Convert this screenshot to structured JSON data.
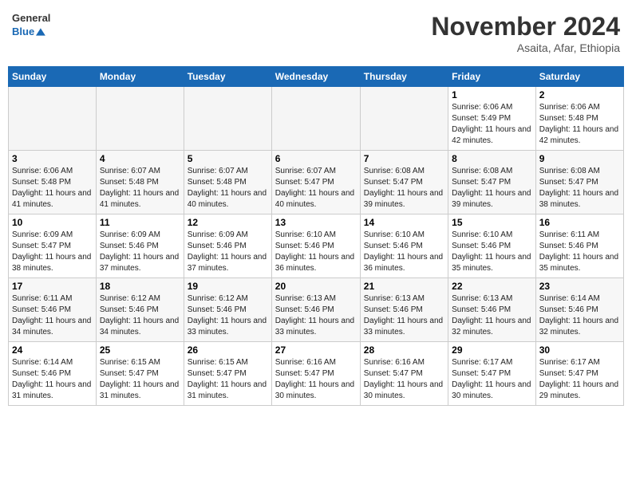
{
  "logo": {
    "line1": "General",
    "line2": "Blue"
  },
  "title": "November 2024",
  "subtitle": "Asaita, Afar, Ethiopia",
  "days_of_week": [
    "Sunday",
    "Monday",
    "Tuesday",
    "Wednesday",
    "Thursday",
    "Friday",
    "Saturday"
  ],
  "weeks": [
    [
      {
        "day": "",
        "info": ""
      },
      {
        "day": "",
        "info": ""
      },
      {
        "day": "",
        "info": ""
      },
      {
        "day": "",
        "info": ""
      },
      {
        "day": "",
        "info": ""
      },
      {
        "day": "1",
        "info": "Sunrise: 6:06 AM\nSunset: 5:49 PM\nDaylight: 11 hours and 42 minutes."
      },
      {
        "day": "2",
        "info": "Sunrise: 6:06 AM\nSunset: 5:48 PM\nDaylight: 11 hours and 42 minutes."
      }
    ],
    [
      {
        "day": "3",
        "info": "Sunrise: 6:06 AM\nSunset: 5:48 PM\nDaylight: 11 hours and 41 minutes."
      },
      {
        "day": "4",
        "info": "Sunrise: 6:07 AM\nSunset: 5:48 PM\nDaylight: 11 hours and 41 minutes."
      },
      {
        "day": "5",
        "info": "Sunrise: 6:07 AM\nSunset: 5:48 PM\nDaylight: 11 hours and 40 minutes."
      },
      {
        "day": "6",
        "info": "Sunrise: 6:07 AM\nSunset: 5:47 PM\nDaylight: 11 hours and 40 minutes."
      },
      {
        "day": "7",
        "info": "Sunrise: 6:08 AM\nSunset: 5:47 PM\nDaylight: 11 hours and 39 minutes."
      },
      {
        "day": "8",
        "info": "Sunrise: 6:08 AM\nSunset: 5:47 PM\nDaylight: 11 hours and 39 minutes."
      },
      {
        "day": "9",
        "info": "Sunrise: 6:08 AM\nSunset: 5:47 PM\nDaylight: 11 hours and 38 minutes."
      }
    ],
    [
      {
        "day": "10",
        "info": "Sunrise: 6:09 AM\nSunset: 5:47 PM\nDaylight: 11 hours and 38 minutes."
      },
      {
        "day": "11",
        "info": "Sunrise: 6:09 AM\nSunset: 5:46 PM\nDaylight: 11 hours and 37 minutes."
      },
      {
        "day": "12",
        "info": "Sunrise: 6:09 AM\nSunset: 5:46 PM\nDaylight: 11 hours and 37 minutes."
      },
      {
        "day": "13",
        "info": "Sunrise: 6:10 AM\nSunset: 5:46 PM\nDaylight: 11 hours and 36 minutes."
      },
      {
        "day": "14",
        "info": "Sunrise: 6:10 AM\nSunset: 5:46 PM\nDaylight: 11 hours and 36 minutes."
      },
      {
        "day": "15",
        "info": "Sunrise: 6:10 AM\nSunset: 5:46 PM\nDaylight: 11 hours and 35 minutes."
      },
      {
        "day": "16",
        "info": "Sunrise: 6:11 AM\nSunset: 5:46 PM\nDaylight: 11 hours and 35 minutes."
      }
    ],
    [
      {
        "day": "17",
        "info": "Sunrise: 6:11 AM\nSunset: 5:46 PM\nDaylight: 11 hours and 34 minutes."
      },
      {
        "day": "18",
        "info": "Sunrise: 6:12 AM\nSunset: 5:46 PM\nDaylight: 11 hours and 34 minutes."
      },
      {
        "day": "19",
        "info": "Sunrise: 6:12 AM\nSunset: 5:46 PM\nDaylight: 11 hours and 33 minutes."
      },
      {
        "day": "20",
        "info": "Sunrise: 6:13 AM\nSunset: 5:46 PM\nDaylight: 11 hours and 33 minutes."
      },
      {
        "day": "21",
        "info": "Sunrise: 6:13 AM\nSunset: 5:46 PM\nDaylight: 11 hours and 33 minutes."
      },
      {
        "day": "22",
        "info": "Sunrise: 6:13 AM\nSunset: 5:46 PM\nDaylight: 11 hours and 32 minutes."
      },
      {
        "day": "23",
        "info": "Sunrise: 6:14 AM\nSunset: 5:46 PM\nDaylight: 11 hours and 32 minutes."
      }
    ],
    [
      {
        "day": "24",
        "info": "Sunrise: 6:14 AM\nSunset: 5:46 PM\nDaylight: 11 hours and 31 minutes."
      },
      {
        "day": "25",
        "info": "Sunrise: 6:15 AM\nSunset: 5:47 PM\nDaylight: 11 hours and 31 minutes."
      },
      {
        "day": "26",
        "info": "Sunrise: 6:15 AM\nSunset: 5:47 PM\nDaylight: 11 hours and 31 minutes."
      },
      {
        "day": "27",
        "info": "Sunrise: 6:16 AM\nSunset: 5:47 PM\nDaylight: 11 hours and 30 minutes."
      },
      {
        "day": "28",
        "info": "Sunrise: 6:16 AM\nSunset: 5:47 PM\nDaylight: 11 hours and 30 minutes."
      },
      {
        "day": "29",
        "info": "Sunrise: 6:17 AM\nSunset: 5:47 PM\nDaylight: 11 hours and 30 minutes."
      },
      {
        "day": "30",
        "info": "Sunrise: 6:17 AM\nSunset: 5:47 PM\nDaylight: 11 hours and 29 minutes."
      }
    ]
  ]
}
